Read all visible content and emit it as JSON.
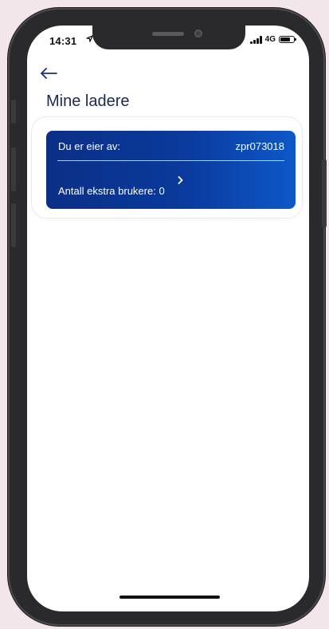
{
  "status_bar": {
    "time": "14:31",
    "network": "4G"
  },
  "header": {
    "back_icon": "arrow-left-icon",
    "title": "Mine ladere"
  },
  "charger_card": {
    "owner_label": "Du er eier av:",
    "charger_id": "zpr073018",
    "extra_users_label": "Antall ekstra brukere: 0",
    "chevron_icon": "chevron-right-icon"
  },
  "colors": {
    "title": "#1a2b4a",
    "card_gradient_start": "#0b2f86",
    "card_gradient_end": "#0d58c9",
    "back_arrow": "#1b2f7a"
  }
}
